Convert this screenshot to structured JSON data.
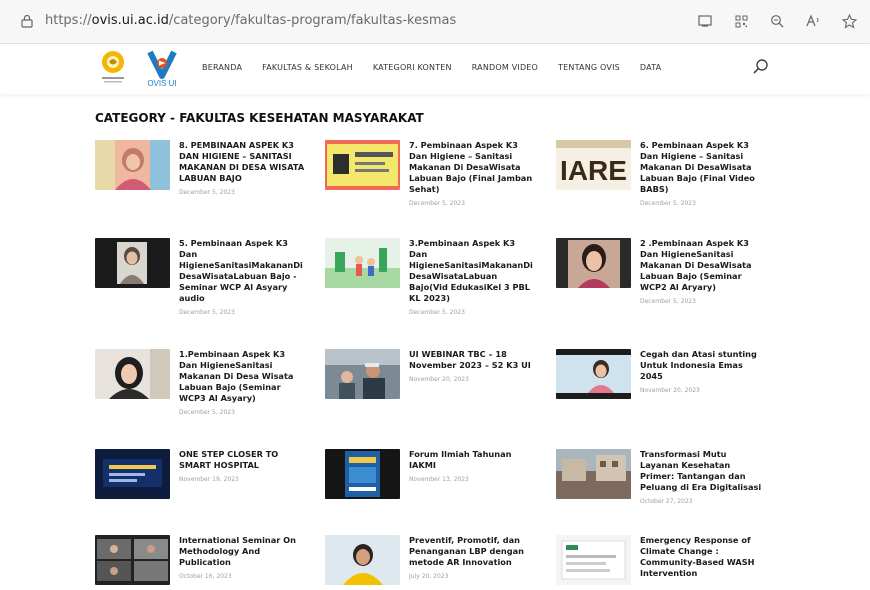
{
  "browser": {
    "url_prefix": "https://",
    "url_host": "ovis.ui.ac.id",
    "url_path": "/category/fakultas-program/fakultas-kesmas"
  },
  "site": {
    "logo_text": "OVIS UI",
    "nav": [
      "BERANDA",
      "FAKULTAS & SEKOLAH",
      "KATEGORI KONTEN",
      "RANDOM VIDEO",
      "TENTANG OVIS",
      "DATA"
    ]
  },
  "category_title": "CATEGORY - FAKULTAS KESEHATAN MASYARAKAT",
  "posts": [
    {
      "title": "8. PEMBINAAN ASPEK K3 DAN HIGIENE – SANITASI MAKANAN DI DESA WISATA LABUAN BAJO",
      "date": "December 5, 2023"
    },
    {
      "title": "7. Pembinaan Aspek K3 Dan Higiene – Sanitasi Makanan Di DesaWisata Labuan Bajo (Final Jamban Sehat)",
      "date": "December 5, 2023"
    },
    {
      "title": "6. Pembinaan Aspek K3 Dan Higiene – Sanitasi Makanan Di DesaWisata Labuan Bajo (Final Video BABS)",
      "date": "December 5, 2023"
    },
    {
      "title": "5. Pembinaan Aspek K3 Dan HigieneSanitasiMakananDi DesaWisataLabuan Bajo - Seminar WCP Al Asyary audio",
      "date": "December 5, 2023"
    },
    {
      "title": "3.Pembinaan Aspek K3 Dan HigieneSanitasiMakananDi DesaWisataLabuan Bajo(Vid EdukasiKel 3 PBL KL 2023)",
      "date": "December 5, 2023"
    },
    {
      "title": "2 .Pembinaan Aspek K3 Dan HigieneSanitasi Makanan Di DesaWisata Labuan Bajo (Seminar WCP2 Al Aryary)",
      "date": "December 5, 2023"
    },
    {
      "title": "1.Pembinaan Aspek K3 Dan HigieneSanitasi Makanan Di Desa Wisata Labuan Bajo (Seminar WCP3 Al Asyary)",
      "date": "December 5, 2023"
    },
    {
      "title": "UI WEBINAR TBC – 18 November 2023 – S2 K3 UI",
      "date": "November 20, 2023"
    },
    {
      "title": "Cegah dan Atasi stunting Untuk Indonesia Emas 2045",
      "date": "November 20, 2023"
    },
    {
      "title": "ONE STEP CLOSER TO SMART HOSPITAL",
      "date": "November 19, 2023"
    },
    {
      "title": "Forum Ilmiah Tahunan IAKMI",
      "date": "November 13, 2023"
    },
    {
      "title": "Transformasi Mutu Layanan Kesehatan Primer: Tantangan dan Peluang di Era Digitalisasi",
      "date": "October 27, 2023"
    },
    {
      "title": "International Seminar On Methodology And Publication",
      "date": "October 16, 2023"
    },
    {
      "title": "Preventif, Promotif, dan Penanganan LBP dengan metode AR Innovation",
      "date": "July 20, 2023"
    },
    {
      "title": "Emergency Response of Climate Change : Community-Based WASH Intervention",
      "date": ""
    }
  ],
  "thumb_text": {
    "iare": "IARE"
  },
  "colors": {
    "accent_blue": "#1f7cc3",
    "ui_yellow": "#f2b705"
  }
}
